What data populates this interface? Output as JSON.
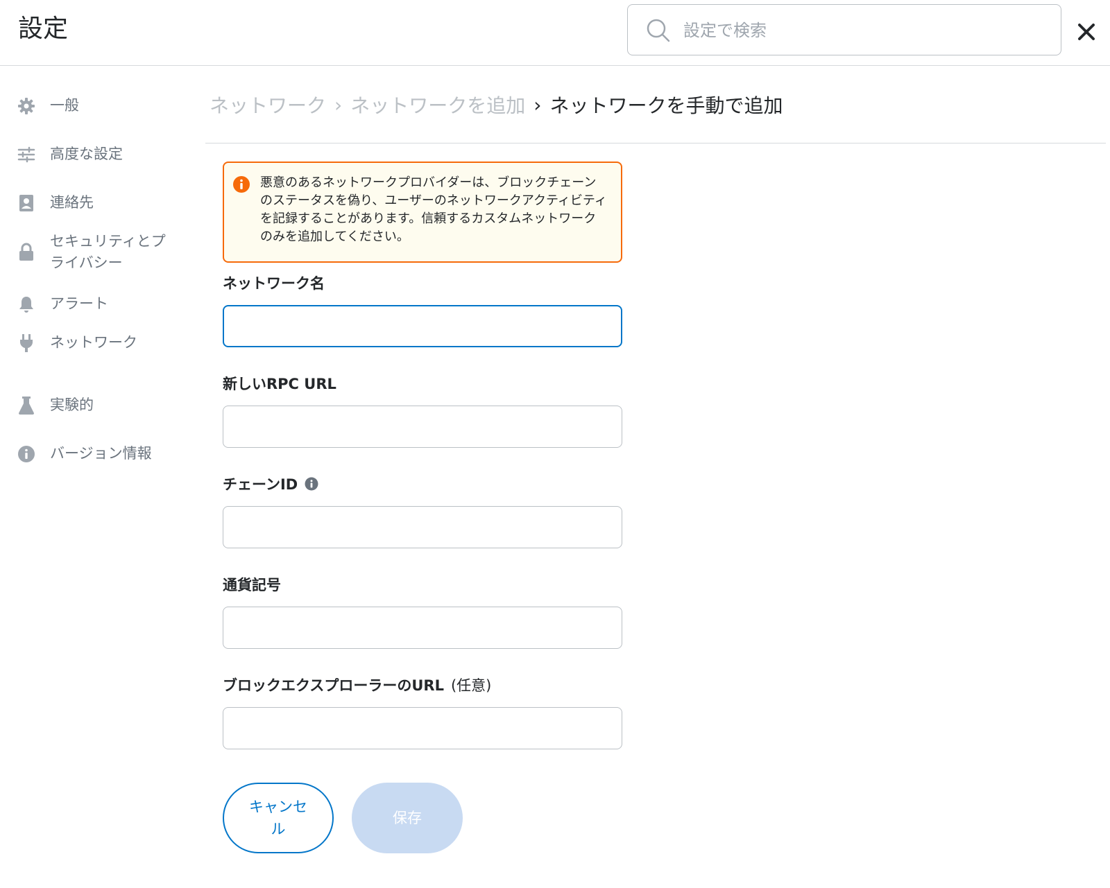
{
  "header": {
    "title": "設定",
    "search_placeholder": "設定で検索",
    "close_icon": "close-icon"
  },
  "sidebar": {
    "items": [
      {
        "label": "一般",
        "icon": "gear-icon"
      },
      {
        "label": "高度な設定",
        "icon": "sliders-icon"
      },
      {
        "label": "連絡先",
        "icon": "contact-book-icon"
      },
      {
        "label": "セキュリティとプライバシー",
        "icon": "lock-icon"
      },
      {
        "label": "アラート",
        "icon": "bell-icon"
      },
      {
        "label": "ネットワーク",
        "icon": "plug-icon"
      },
      {
        "label": "実験的",
        "icon": "flask-icon"
      },
      {
        "label": "バージョン情報",
        "icon": "info-icon"
      }
    ]
  },
  "breadcrumb": {
    "items": [
      "ネットワーク",
      "ネットワークを追加",
      "ネットワークを手動で追加"
    ],
    "separator": "›"
  },
  "warning": {
    "text": "悪意のあるネットワークプロバイダーは、ブロックチェーンのステータスを偽り、ユーザーのネットワークアクティビティを記録することがあります。信頼するカスタムネットワークのみを追加してください。",
    "icon": "warning-info-icon"
  },
  "form": {
    "network_name": {
      "label": "ネットワーク名",
      "value": ""
    },
    "rpc_url": {
      "label": "新しいRPC URL",
      "value": ""
    },
    "chain_id": {
      "label": "チェーンID",
      "value": ""
    },
    "currency_symbol": {
      "label": "通貨記号",
      "value": ""
    },
    "explorer_url": {
      "label": "ブロックエクスプローラーのURL",
      "optional": "(任意)",
      "value": ""
    }
  },
  "buttons": {
    "cancel": "キャンセル",
    "save": "保存"
  },
  "colors": {
    "accent": "#0376c9",
    "warning_border": "#f66a0a",
    "warning_bg": "#fefcef",
    "save_disabled": "#c8daf2"
  }
}
